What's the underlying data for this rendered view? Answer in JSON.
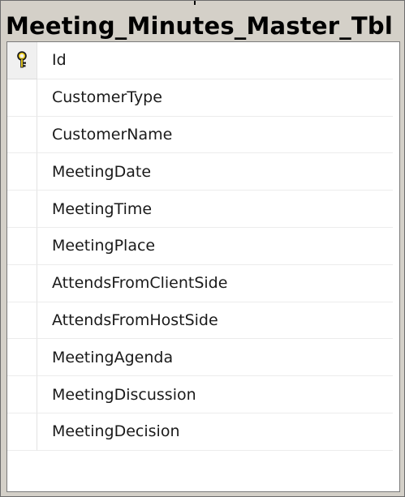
{
  "table": {
    "title": "Meeting_Minutes_Master_Tbl",
    "columns": [
      {
        "name": "Id",
        "primary_key": true,
        "icon": "primary-key-icon"
      },
      {
        "name": "CustomerType"
      },
      {
        "name": "CustomerName"
      },
      {
        "name": "MeetingDate"
      },
      {
        "name": "MeetingTime"
      },
      {
        "name": "MeetingPlace"
      },
      {
        "name": "AttendsFromClientSide"
      },
      {
        "name": "AttendsFromHostSide"
      },
      {
        "name": "MeetingAgenda"
      },
      {
        "name": "MeetingDiscussion"
      },
      {
        "name": "MeetingDecision"
      }
    ]
  },
  "colors": {
    "frame": "#d4d0c8",
    "panel": "#ffffff",
    "key_icon": "#e8c400"
  }
}
